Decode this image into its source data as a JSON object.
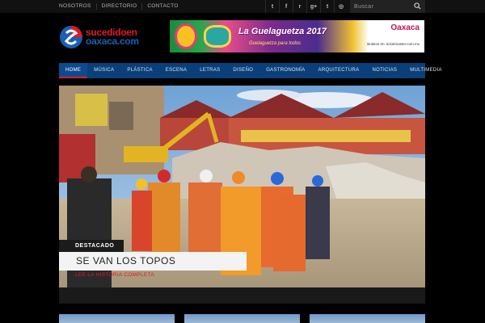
{
  "topbar": {
    "links": [
      "NOSOTROS",
      "DIRECTORIO",
      "CONTACTO"
    ],
    "social": [
      {
        "icon": "twitter-icon",
        "glyph": "t"
      },
      {
        "icon": "facebook-icon",
        "glyph": "f"
      },
      {
        "icon": "rss-icon",
        "glyph": "r"
      },
      {
        "icon": "google-plus-icon",
        "glyph": "g+"
      },
      {
        "icon": "tumblr-icon",
        "glyph": "t"
      },
      {
        "icon": "instagram-icon",
        "glyph": "◎"
      }
    ],
    "search_placeholder": "Buscar"
  },
  "header": {
    "logo_line1": "sucedidoen",
    "logo_line2": "oaxaca.com",
    "banner": {
      "title": "La Guelaguetza 2017",
      "subtitle": "Guelaguetza para todos",
      "brand": "Oaxaca",
      "small": "Boletos en: ticketmaster.com.mx"
    }
  },
  "nav": {
    "items": [
      "HOME",
      "MÚSICA",
      "PLÁSTICA",
      "ESCENA",
      "LETRAS",
      "DISEÑO",
      "GASTRONOMÍA",
      "ARQUITECTURA",
      "NOTICIAS",
      "MULTIMEDIA"
    ],
    "active": "HOME"
  },
  "hero": {
    "tag": "DESTACADO",
    "headline": "SE VAN LOS TOPOS",
    "readmore": "LEE LA HISTORIA COMPLETA"
  },
  "colors": {
    "accent": "#e01a27",
    "nav_bg": "#0b3f7a",
    "brand_blue": "#1a5fb4"
  }
}
